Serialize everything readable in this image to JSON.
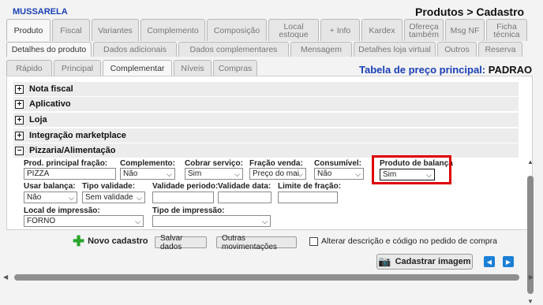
{
  "product": {
    "name": "MUSSARELA"
  },
  "page_title": "Produtos > Cadastro",
  "tabs_main": [
    "Produto",
    "Fiscal",
    "Variantes",
    "Complemento",
    "Composição",
    "Local estoque",
    "+ Info",
    "Kardex",
    "Ofereça também",
    "Msg NF",
    "Ficha técnica"
  ],
  "tabs_sub": [
    "Detalhes do produto",
    "Dados adicionais",
    "Dados complementares",
    "Mensagem",
    "Detalhes loja virtual",
    "Outros",
    "Reserva"
  ],
  "tabs_sub2": [
    "Rápido",
    "Principal",
    "Complementar",
    "Níveis",
    "Compras"
  ],
  "price_table": {
    "label": "Tabela de preço principal:",
    "value": "PADRAO"
  },
  "sections": [
    {
      "label": "Nota fiscal",
      "toggle": "+"
    },
    {
      "label": "Aplicativo",
      "toggle": "+"
    },
    {
      "label": "Loja",
      "toggle": "+"
    },
    {
      "label": "Integração marketplace",
      "toggle": "+"
    },
    {
      "label": "Pizzaria/Alimentação",
      "toggle": "−"
    }
  ],
  "fields": {
    "prod_principal": {
      "label": "Prod. principal fração:",
      "value": "PIZZA"
    },
    "complemento": {
      "label": "Complemento:",
      "value": "Não"
    },
    "cobrar_servico": {
      "label": "Cobrar serviço:",
      "value": "Sim"
    },
    "fracao_venda": {
      "label": "Fração venda:",
      "value": "Preço do mai"
    },
    "consumivel": {
      "label": "Consumível:",
      "value": "Não"
    },
    "produto_balanca": {
      "label": "Produto de balança",
      "value": "Sim"
    },
    "usar_balanca": {
      "label": "Usar balança:",
      "value": "Não"
    },
    "tipo_validade": {
      "label": "Tipo validade:",
      "value": "Sem validade"
    },
    "validade_periodo": {
      "label": "Validade periodo:",
      "value": ""
    },
    "validade_data": {
      "label": "Validade data:",
      "value": ""
    },
    "limite_fracao": {
      "label": "Limite de fração:",
      "value": ""
    },
    "local_impressao": {
      "label": "Local de impressão:",
      "value": "FORNO"
    },
    "tipo_impressao": {
      "label": "Tipo de impressão:",
      "value": ""
    }
  },
  "footer": {
    "novo_cadastro": "Novo cadastro",
    "salvar": "Salvar dados",
    "outras": "Outras movimentações",
    "alterar_desc": "Alterar descrição e código no pedido de compra",
    "cadastrar_imagem": "Cadastrar imagem"
  },
  "colors": {
    "accent": "#1a3fb5",
    "highlight": "#dd0000",
    "nav": "#1b7fd6"
  }
}
